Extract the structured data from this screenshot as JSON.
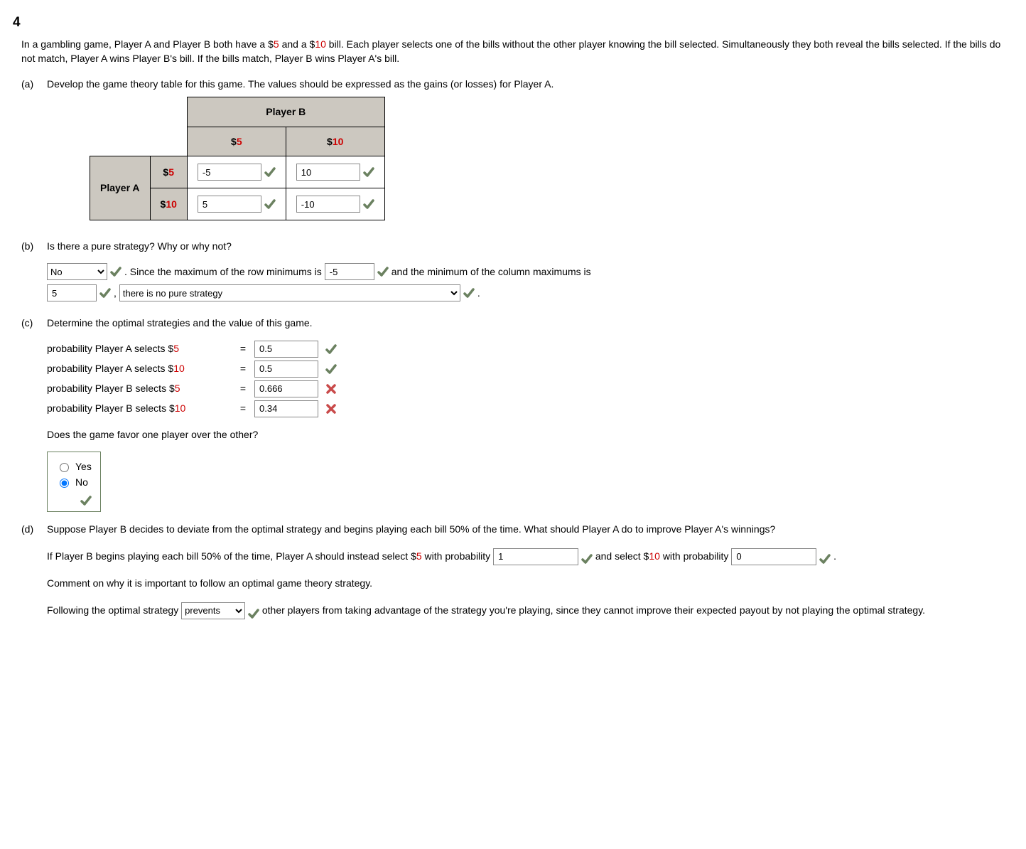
{
  "question_number": "4",
  "stem_pre": "In a gambling game, Player A and Player B both have a $",
  "stem_amt1": "5",
  "stem_mid1": " and a $",
  "stem_amt2": "10",
  "stem_post": " bill. Each player selects one of the bills without the other player knowing the bill selected. Simultaneously they both reveal the bills selected. If the bills do not match, Player A wins Player B's bill. If the bills match, Player B wins Player A's bill.",
  "a": {
    "label": "(a)",
    "prompt": "Develop the game theory table for this game. The values should be expressed as the gains (or losses) for Player A.",
    "table": {
      "col_title": "Player B",
      "row_title": "Player A",
      "cols": [
        "$5",
        "$10"
      ],
      "rows": [
        "$5",
        "$10"
      ],
      "values": [
        [
          "-5",
          "10"
        ],
        [
          "5",
          "-10"
        ]
      ]
    }
  },
  "b": {
    "label": "(b)",
    "prompt": "Is there a pure strategy? Why or why not?",
    "select_answer": "No",
    "sentence1_pre": ". Since the maximum of the row minimums is ",
    "row_min_max": "-5",
    "sentence1_post": " and the minimum of the column maximums is",
    "col_max_min": "5",
    "comma": ",",
    "reason_selected": "there is no pure strategy",
    "period": "."
  },
  "c": {
    "label": "(c)",
    "prompt": "Determine the optimal strategies and the value of this game.",
    "rows": [
      {
        "label_pre": "probability Player A selects $",
        "dollar": "5",
        "value": "0.5",
        "mark": "check"
      },
      {
        "label_pre": "probability Player A selects $",
        "dollar": "10",
        "value": "0.5",
        "mark": "check"
      },
      {
        "label_pre": "probability Player B selects $",
        "dollar": "5",
        "value": "0.666",
        "mark": "cross"
      },
      {
        "label_pre": "probability Player B selects $",
        "dollar": "10",
        "value": "0.34",
        "mark": "cross"
      }
    ],
    "favor_q": "Does the game favor one player over the other?",
    "options": [
      "Yes",
      "No"
    ],
    "selected": "No"
  },
  "d": {
    "label": "(d)",
    "prompt_pre": "Suppose Player B decides to deviate from the optimal strategy and begins playing each bill ",
    "prompt_pct": "50%",
    "prompt_post": " of the time. What should Player A do to improve Player A's winnings?",
    "line2_pre1": "If Player B begins playing each bill ",
    "line2_pct": "50%",
    "line2_mid": " of the time, Player A should instead select $",
    "line2_amt1": "5",
    "line2_probword": " with probability ",
    "p5": "1",
    "line2_and": " and select $",
    "line2_amt2": "10",
    "line2_withprob2": "with probability ",
    "p10": "0",
    "period": ".",
    "comment_prompt": "Comment on why it is important to follow an optimal game theory strategy.",
    "follow_pre": "Following the optimal strategy ",
    "follow_sel": "prevents",
    "follow_post": " other players from taking advantage of the strategy you're playing, since they cannot improve their expected payout by not playing the optimal strategy."
  }
}
